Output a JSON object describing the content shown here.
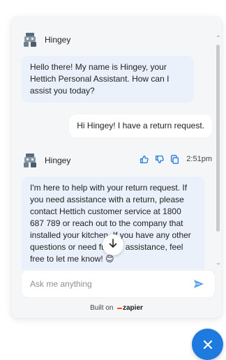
{
  "bot": {
    "name": "Hingey"
  },
  "messages": [
    {
      "role": "bot",
      "text": "Hello there! My name is Hingey, your Hettich Personal Assistant. How can I assist you today?"
    },
    {
      "role": "user",
      "text": "Hi Hingey! I have a return request."
    },
    {
      "role": "bot",
      "time": "2:51pm",
      "text": "I'm here to help with your return request. If you need assistance with a return, please contact Hettich customer service at 1800 687 789 or reach out to the company that installed your kitchen. If you have any other questions or need further assistance, feel free to let me know! 😊"
    }
  ],
  "composer": {
    "placeholder": "Ask me anything"
  },
  "footer": {
    "built_on": "Built on",
    "brand": "zapier"
  },
  "icons": {
    "avatar": "robot-avatar-icon",
    "thumbs_up": "thumbs-up-icon",
    "thumbs_down": "thumbs-down-icon",
    "copy": "copy-icon",
    "scroll_down": "arrow-down-icon",
    "send": "send-icon",
    "close": "close-icon"
  },
  "colors": {
    "accent": "#1f7ae0",
    "send": "#5aa2ee",
    "bot_bubble": "#eaf1fb",
    "brand_orange": "#ff4f00"
  }
}
